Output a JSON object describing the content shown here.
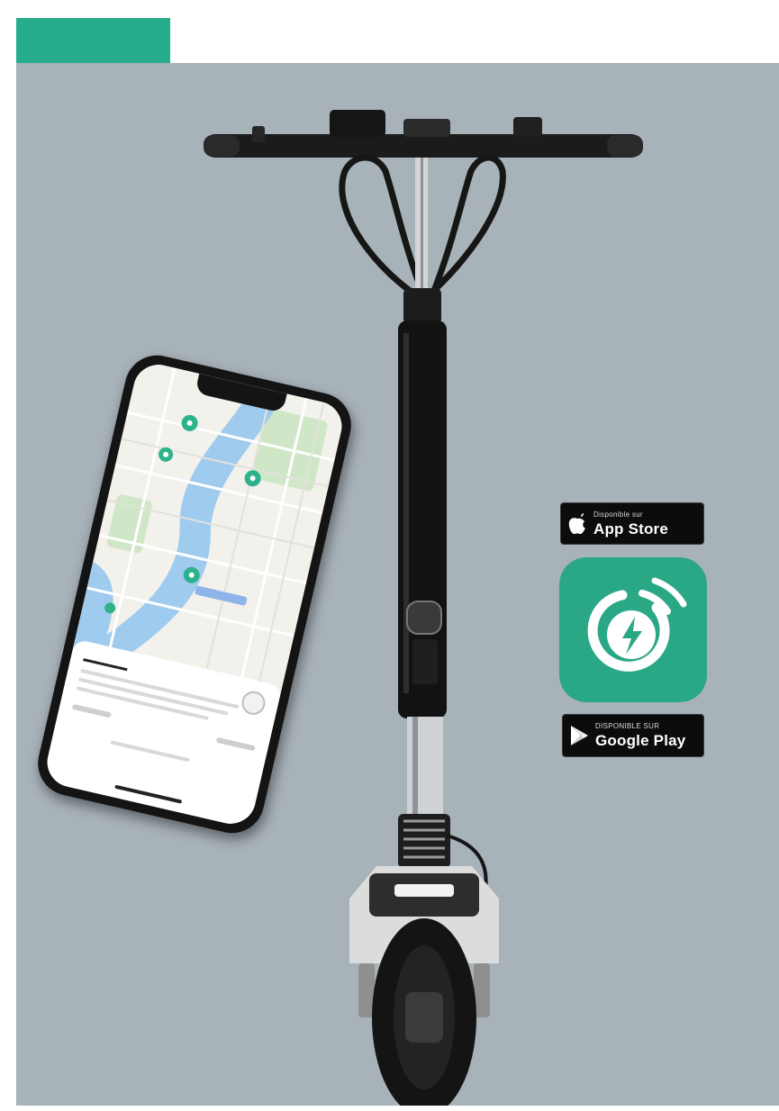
{
  "colors": {
    "accent": "#27ad8c",
    "background": "#a8b2b9",
    "badge_bg": "#0c0c0c",
    "app_icon_bg": "#2aa886",
    "map_water": "#9fcbee",
    "map_park": "#cfe7c6",
    "map_pin": "#2db38a"
  },
  "badges": {
    "appstore": {
      "icon": "apple-icon",
      "small": "Disponible sur",
      "big": "App Store"
    },
    "googleplay": {
      "icon": "google-play-icon",
      "small": "DISPONIBLE SUR",
      "big": "Google Play"
    }
  },
  "app_icon": {
    "icon": "lightning-bolt-icon"
  },
  "phone": {
    "icon": "map-pin-icon"
  }
}
